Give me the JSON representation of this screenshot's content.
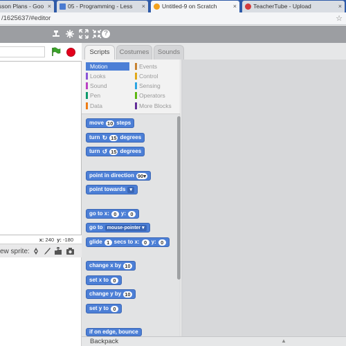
{
  "browser": {
    "tabs": [
      {
        "label": "sson Plans - Goo",
        "favicon_color": "#2e7d32"
      },
      {
        "label": "05 - Programming - Less",
        "favicon_color": "#4a7bd1"
      },
      {
        "label": "Untitled-9 on Scratch",
        "favicon_color": "#f2a11c"
      },
      {
        "label": "TeacherTube - Upload",
        "favicon_color": "#d23b3b"
      }
    ],
    "url": "/1625637/#editor"
  },
  "menubar_icons": [
    "duplicate-icon",
    "cut-icon",
    "grow-icon",
    "shrink-icon",
    "help-icon"
  ],
  "stage": {
    "x_label": "x:",
    "x_value": "240",
    "y_label": "y:",
    "y_value": "-180"
  },
  "sprite_bar": {
    "label": "ew sprite:"
  },
  "panel_tabs": [
    "Scripts",
    "Costumes",
    "Sounds"
  ],
  "categories": {
    "left": [
      {
        "label": "Motion",
        "color": "#4c7fd6",
        "selected": true
      },
      {
        "label": "Looks",
        "color": "#8a55d7"
      },
      {
        "label": "Sound",
        "color": "#bb42c3"
      },
      {
        "label": "Pen",
        "color": "#0e9a6c"
      },
      {
        "label": "Data",
        "color": "#ee7d16"
      }
    ],
    "right": [
      {
        "label": "Events",
        "color": "#c88330"
      },
      {
        "label": "Control",
        "color": "#e1a91a"
      },
      {
        "label": "Sensing",
        "color": "#2ca5e2"
      },
      {
        "label": "Operators",
        "color": "#5cb712"
      },
      {
        "label": "More Blocks",
        "color": "#632d99"
      }
    ]
  },
  "blocks": {
    "move": {
      "text": "move",
      "value": "10",
      "suffix": "steps"
    },
    "turn_right": {
      "text": "turn",
      "value": "15",
      "suffix": "degrees"
    },
    "turn_left": {
      "text": "turn",
      "value": "15",
      "suffix": "degrees"
    },
    "point_direction": {
      "text": "point in direction",
      "value": "90▾"
    },
    "point_towards": {
      "text": "point towards",
      "value": "▾"
    },
    "go_to_xy": {
      "text": "go to x:",
      "x": "0",
      "y_label": "y:",
      "y": "0"
    },
    "go_to": {
      "text": "go to",
      "value": "mouse-pointer ▾"
    },
    "glide": {
      "text": "glide",
      "value": "1",
      "mid": "secs to x:",
      "x": "0",
      "y_label": "y:",
      "y": "0"
    },
    "change_x": {
      "text": "change x by",
      "value": "10"
    },
    "set_x": {
      "text": "set x to",
      "value": "0"
    },
    "change_y": {
      "text": "change y by",
      "value": "10"
    },
    "set_y": {
      "text": "set y to",
      "value": "0"
    },
    "bounce": {
      "text": "if on edge, bounce"
    }
  },
  "backpack": {
    "label": "Backpack",
    "arrow": "▲"
  }
}
